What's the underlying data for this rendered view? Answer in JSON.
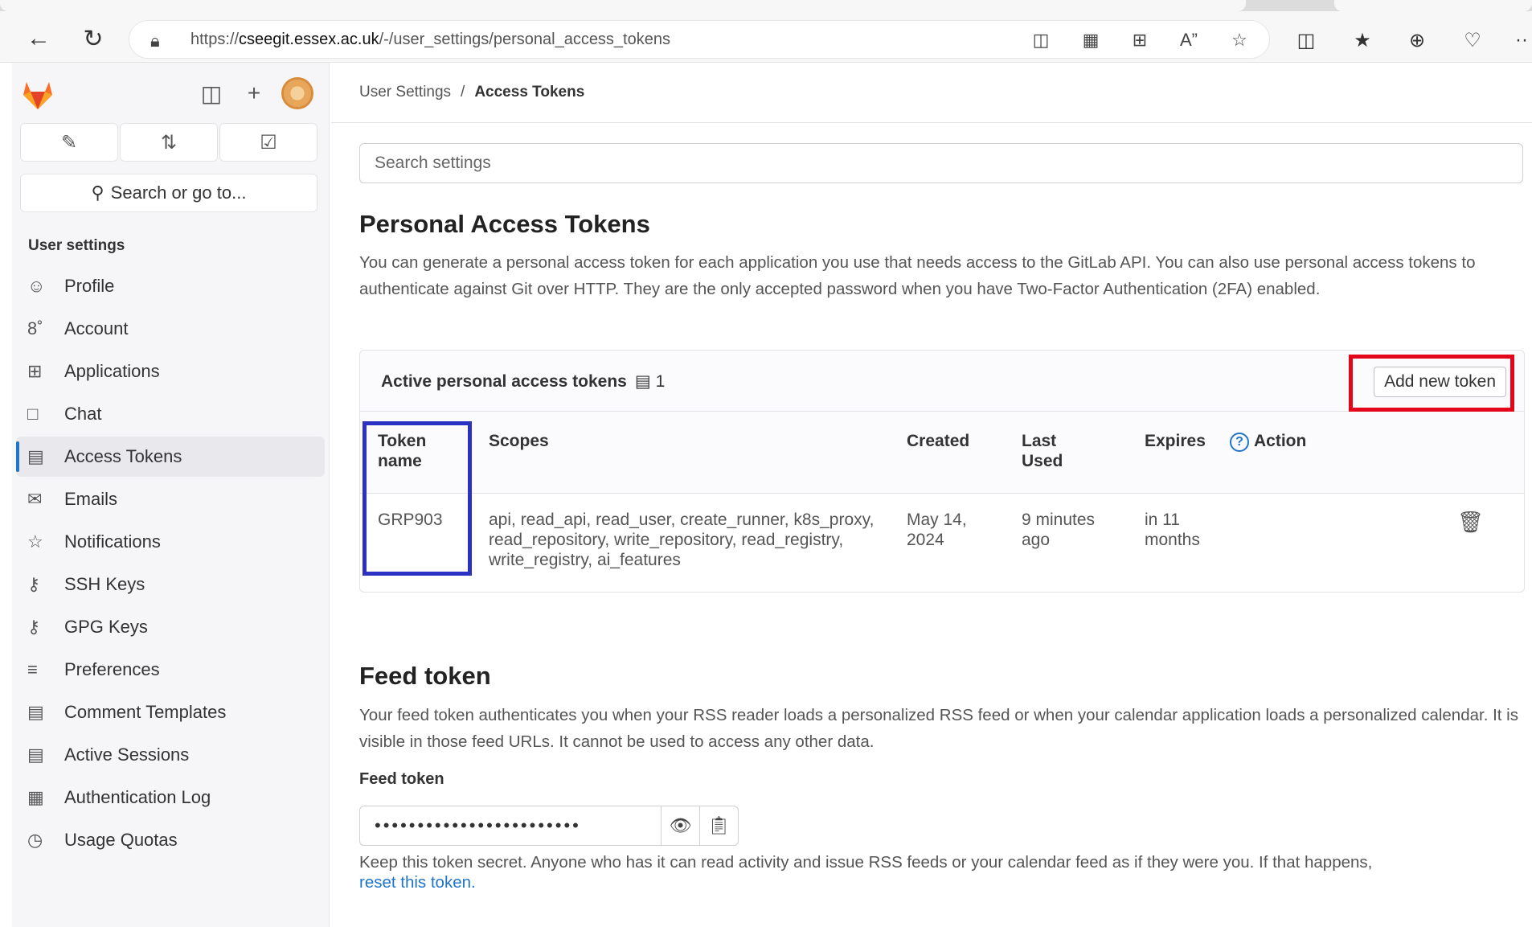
{
  "browser": {
    "url_prefix": "https://",
    "url_host": "cseegit.essex.ac.uk",
    "url_path": "/-/user_settings/personal_access_tokens"
  },
  "sidebar": {
    "search_label": "Search or go to...",
    "section_title": "User settings",
    "items": [
      {
        "label": "Profile",
        "icon": "profile-icon"
      },
      {
        "label": "Account",
        "icon": "account-icon"
      },
      {
        "label": "Applications",
        "icon": "applications-icon"
      },
      {
        "label": "Chat",
        "icon": "chat-icon"
      },
      {
        "label": "Access Tokens",
        "icon": "token-icon",
        "active": true
      },
      {
        "label": "Emails",
        "icon": "mail-icon"
      },
      {
        "label": "Notifications",
        "icon": "bell-icon"
      },
      {
        "label": "SSH Keys",
        "icon": "key-icon"
      },
      {
        "label": "GPG Keys",
        "icon": "key-icon"
      },
      {
        "label": "Preferences",
        "icon": "preferences-icon"
      },
      {
        "label": "Comment Templates",
        "icon": "comment-icon"
      },
      {
        "label": "Active Sessions",
        "icon": "monitor-icon"
      },
      {
        "label": "Authentication Log",
        "icon": "log-icon"
      },
      {
        "label": "Usage Quotas",
        "icon": "quota-icon"
      }
    ]
  },
  "breadcrumb": {
    "parent": "User Settings",
    "separator": "/",
    "current": "Access Tokens"
  },
  "search": {
    "placeholder": "Search settings"
  },
  "pat": {
    "title": "Personal Access Tokens",
    "description": "You can generate a personal access token for each application you use that needs access to the GitLab API. You can also use personal access tokens to authenticate against Git over HTTP. They are the only accepted password when you have Two-Factor Authentication (2FA) enabled.",
    "card_title": "Active personal access tokens",
    "count": "1",
    "add_button": "Add new token",
    "columns": {
      "name": "Token name",
      "scopes": "Scopes",
      "created": "Created",
      "last_used": "Last Used",
      "expires": "Expires",
      "action": "Action"
    },
    "rows": [
      {
        "name": "GRP903",
        "scopes": "api, read_api, read_user, create_runner, k8s_proxy, read_repository, write_repository, read_registry, write_registry, ai_features",
        "created": "May 14, 2024",
        "last_used": "9 minutes ago",
        "expires": "in 11 months"
      }
    ]
  },
  "feed": {
    "title": "Feed token",
    "description": "Your feed token authenticates you when your RSS reader loads a personalized RSS feed or when your calendar application loads a personalized calendar. It is visible in those feed URLs. It cannot be used to access any other data.",
    "field_label": "Feed token",
    "masked_value": "••••••••••••••••••••••••",
    "help": "Keep this token secret. Anyone who has it can read activity and issue RSS feeds or your calendar feed as if they were you. If that happens,",
    "reset_link": "reset this token."
  },
  "colors": {
    "accent": "#1f75cb",
    "highlight_red": "#e3061b",
    "highlight_blue": "#2b32c3"
  }
}
